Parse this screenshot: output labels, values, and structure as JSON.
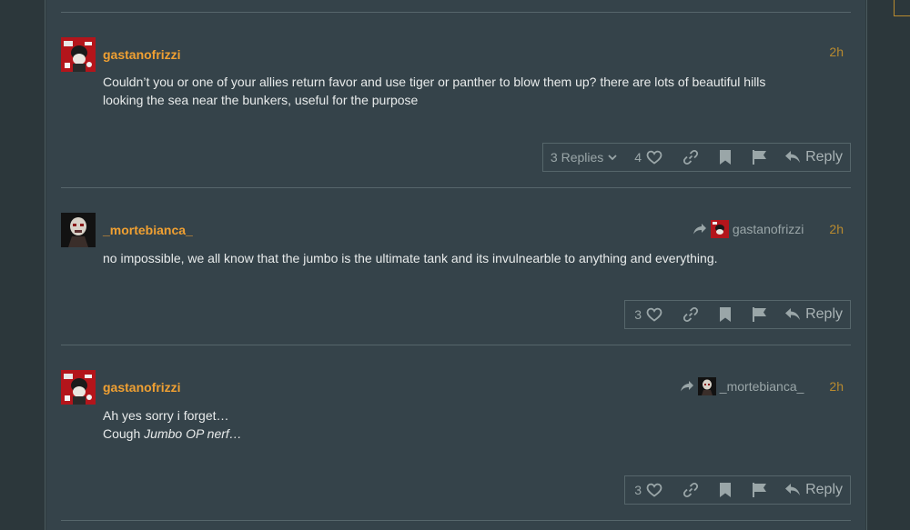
{
  "posts": [
    {
      "username": "gastanofrizzi",
      "time": "2h",
      "reply_to": "",
      "lines": [
        "Couldn’t you or one of your allies return favor and use tiger or panther to blow them up? there are lots of beautiful hills",
        "looking the sea near the bunkers, useful for the purpose"
      ],
      "replies_label": "3 Replies",
      "likes": "4",
      "reply_label": "Reply"
    },
    {
      "username": "_mortebianca_",
      "time": "2h",
      "reply_to": "gastanofrizzi",
      "lines": [
        "no impossible, we all know that the jumbo is the ultimate tank and its invulnearble to anything and everything."
      ],
      "likes": "3",
      "reply_label": "Reply"
    },
    {
      "username": "gastanofrizzi",
      "time": "2h",
      "reply_to": "_mortebianca_",
      "line1": "Ah yes sorry i forget…",
      "line2_prefix": "Cough ",
      "line2_em": "Jumbo OP nerf…",
      "likes": "3",
      "reply_label": "Reply"
    }
  ],
  "colors": {
    "accent": "#f0a032",
    "background": "#35434a",
    "muted": "#9aa6a8"
  },
  "icons": [
    "chevron-down-icon",
    "heart-icon",
    "link-icon",
    "bookmark-icon",
    "flag-icon",
    "reply-icon",
    "share-arrow-icon"
  ]
}
